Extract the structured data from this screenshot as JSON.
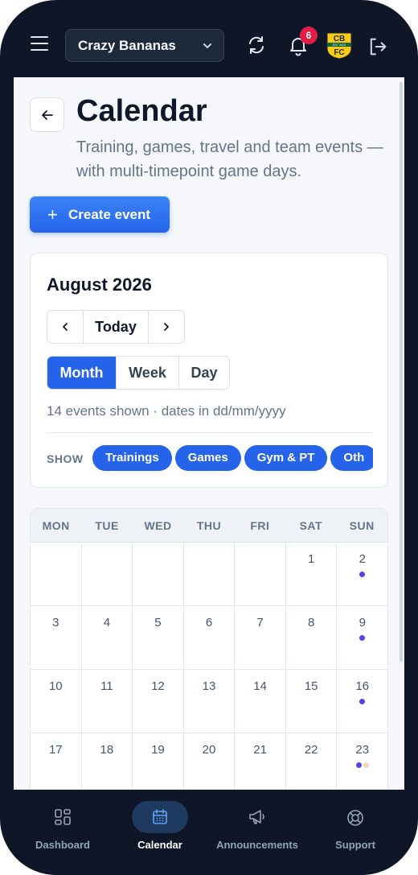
{
  "header": {
    "team_name": "Crazy Bananas",
    "notification_count": "6",
    "crest_text_top": "CB",
    "crest_text_bottom": "FC",
    "crest_text_small": "EST. 2023"
  },
  "page": {
    "title": "Calendar",
    "subtitle": "Training, games, travel and team events — with multi-timepoint game days.",
    "create_button": "Create event",
    "create_plus": "+"
  },
  "controls": {
    "month_title": "August 2026",
    "prev_icon": "chevron-left-icon",
    "today_label": "Today",
    "next_icon": "chevron-right-icon",
    "views": [
      "Month",
      "Week",
      "Day"
    ],
    "active_view": "Month",
    "events_info": "14 events shown · dates in dd/mm/yyyy",
    "show_label": "SHOW",
    "filters": [
      "Trainings",
      "Games",
      "Gym & PT",
      "Oth"
    ]
  },
  "calendar": {
    "weekdays": [
      "MON",
      "TUE",
      "WED",
      "THU",
      "FRI",
      "SAT",
      "SUN"
    ],
    "weeks": [
      [
        "",
        "",
        "",
        "",
        "",
        "1",
        "2"
      ],
      [
        "3",
        "4",
        "5",
        "6",
        "7",
        "8",
        "9"
      ],
      [
        "10",
        "11",
        "12",
        "13",
        "14",
        "15",
        "16"
      ],
      [
        "17",
        "18",
        "19",
        "20",
        "21",
        "22",
        "23"
      ]
    ],
    "event_dots": {
      "2": [
        "#4f46e5"
      ],
      "9": [
        "#4f46e5"
      ],
      "16": [
        "#4f46e5"
      ],
      "23": [
        "#4f46e5",
        "#f5d0c5"
      ]
    }
  },
  "bottom_nav": [
    {
      "label": "Dashboard",
      "icon": "dashboard-icon"
    },
    {
      "label": "Calendar",
      "icon": "calendar-icon",
      "active": true
    },
    {
      "label": "Announcements",
      "icon": "megaphone-icon"
    },
    {
      "label": "Support",
      "icon": "lifebuoy-icon"
    }
  ],
  "colors": {
    "primary": "#2563eb",
    "frame": "#0e1628",
    "badge": "#e11d48",
    "event_dot": "#4f46e5"
  }
}
